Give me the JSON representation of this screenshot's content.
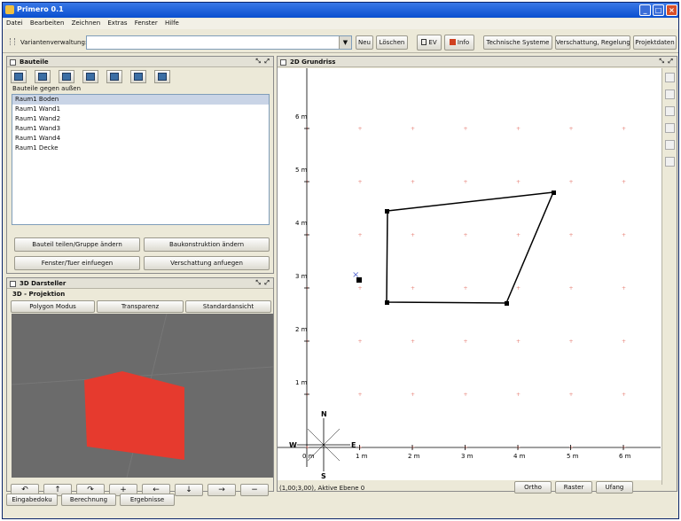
{
  "window": {
    "title": "Primero 0.1"
  },
  "menu": [
    "Datei",
    "Bearbeiten",
    "Zeichnen",
    "Extras",
    "Fenster",
    "Hilfe"
  ],
  "toolbar": {
    "variant_label": "Variantenverwaltung:",
    "variant_value": "",
    "neu": "Neu",
    "loeschen": "Löschen",
    "ev": "EV",
    "info": "Info",
    "technische": "Technische Systeme",
    "verschattung": "Verschattung, Regelung",
    "projektdaten": "Projektdaten"
  },
  "bauteile": {
    "title": "Bauteile",
    "list_label": "Bauteile gegen außen",
    "items": [
      "Raum1 Boden",
      "Raum1 Wand1",
      "Raum1 Wand2",
      "Raum1 Wand3",
      "Raum1 Wand4",
      "Raum1 Decke"
    ],
    "btn_group": "Bauteil teilen/Gruppe ändern",
    "btn_construct": "Baukonstruktion ändern",
    "btn_window": "Fenster/Tuer einfuegen",
    "btn_shade": "Verschattung anfuegen"
  },
  "darsteller": {
    "title": "3D Darsteller",
    "projection": "3D - Projektion",
    "btn_polygon": "Polygon Modus",
    "btn_transparenz": "Transparenz",
    "btn_standard": "Standardansicht",
    "polygon_color": "#e63a2e",
    "arrows": [
      "↶",
      "↑",
      "↷",
      "+",
      "←",
      "↓",
      "→",
      "−"
    ]
  },
  "grundriss": {
    "title": "2D Grundriss",
    "y_labels": [
      "6 m",
      "5 m",
      "4 m",
      "3 m",
      "2 m",
      "1 m"
    ],
    "x_labels": [
      "0 m",
      "1 m",
      "2 m",
      "3 m",
      "4 m",
      "5 m",
      "6 m"
    ],
    "compass": {
      "n": "N",
      "s": "S",
      "e": "E",
      "w": "W"
    },
    "grid_color": "#e8847a",
    "status": "(1,00;3,00), Aktive Ebene 0",
    "btn_ortho": "Ortho",
    "btn_raster": "Raster",
    "btn_ufang": "Ufang"
  },
  "tabs": [
    "Eingabedoku",
    "Berechnung",
    "Ergebnisse"
  ]
}
